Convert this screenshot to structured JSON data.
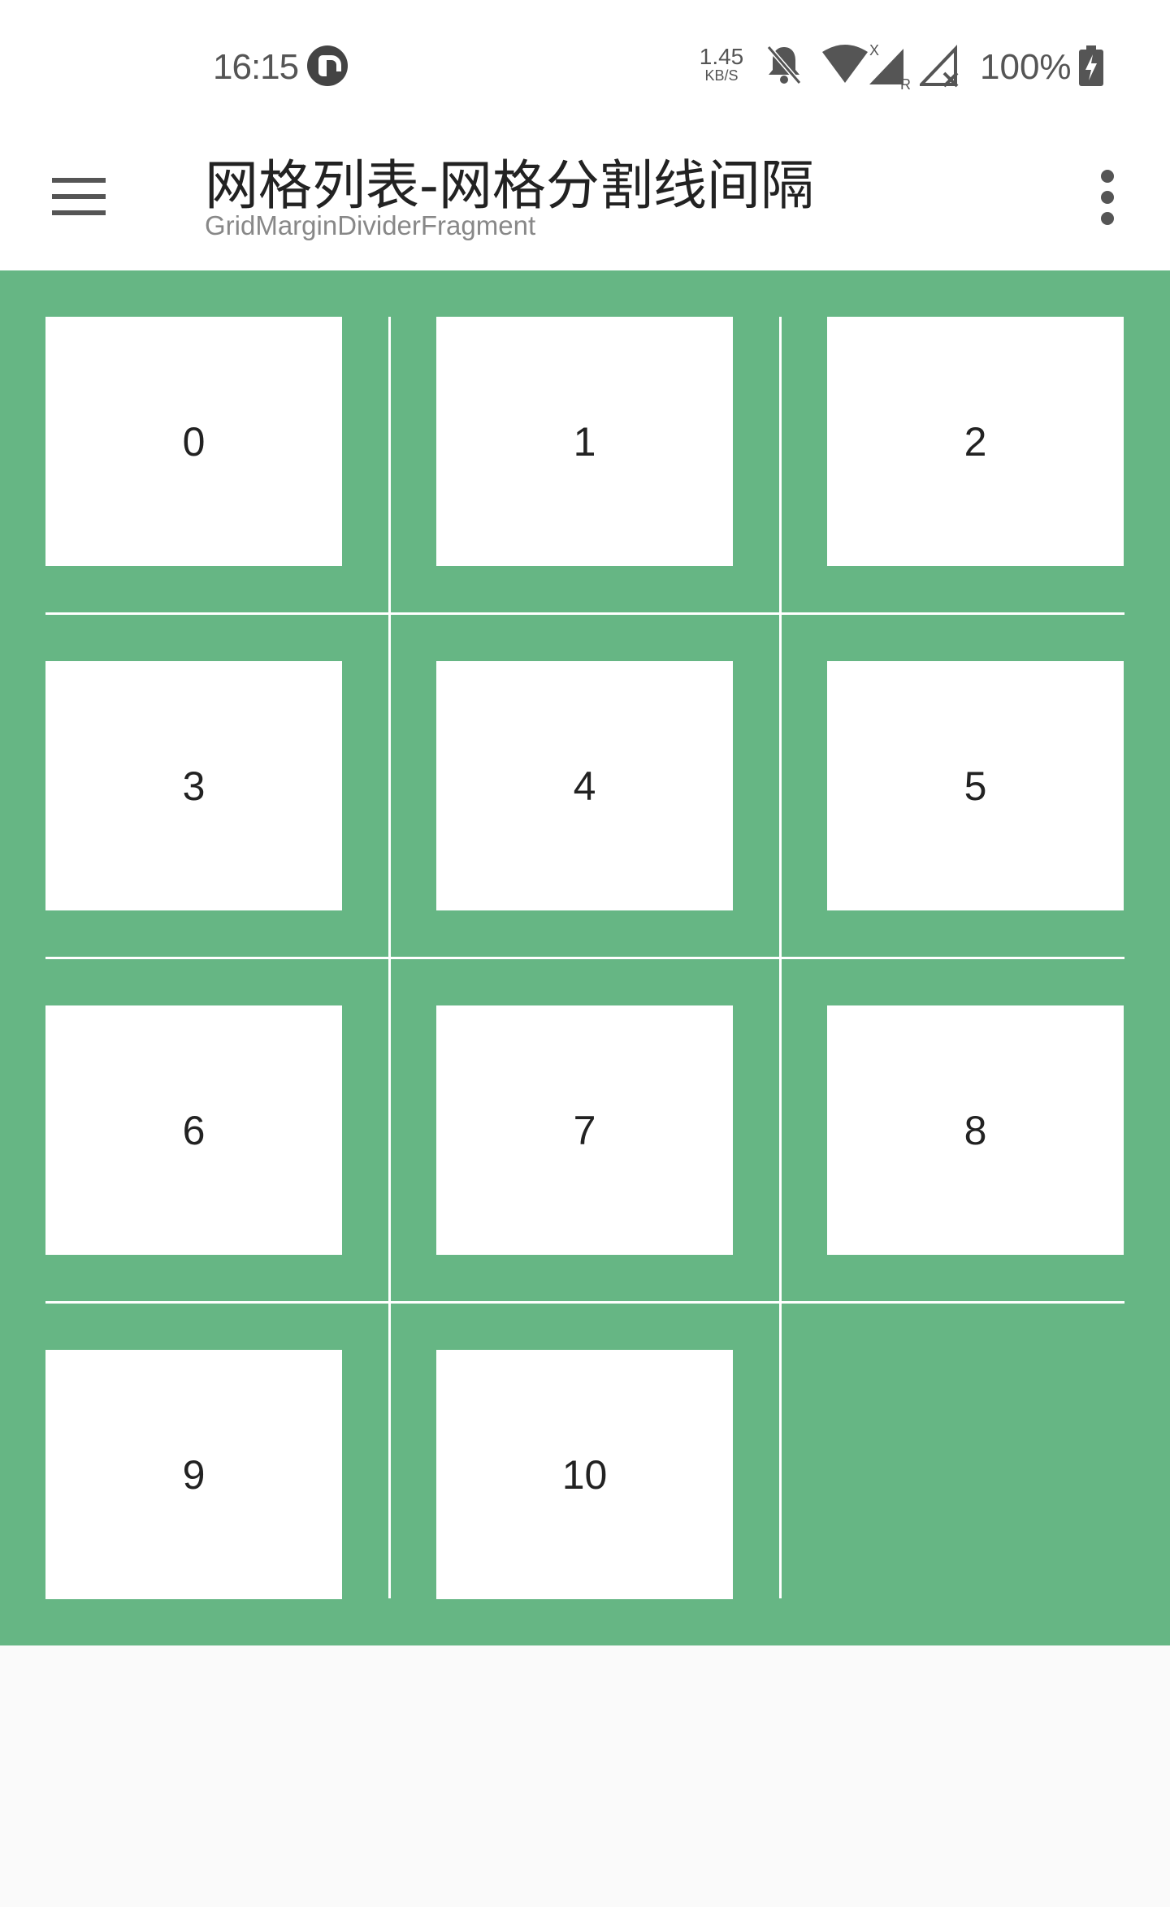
{
  "status_bar": {
    "time": "16:15",
    "net_speed_value": "1.45",
    "net_speed_unit": "KB/S",
    "battery": "100%",
    "icons": [
      "app-icon",
      "bell-off-icon",
      "wifi-icon",
      "signal-r-icon",
      "signal-x-icon",
      "battery-charging-icon"
    ]
  },
  "toolbar": {
    "title": "网格列表-网格分割线间隔",
    "subtitle": "GridMarginDividerFragment",
    "menu_icon": "hamburger-menu-icon",
    "overflow_icon": "more-vertical-icon"
  },
  "grid": {
    "items": [
      "0",
      "1",
      "2",
      "3",
      "4",
      "5",
      "6",
      "7",
      "8",
      "9",
      "10"
    ],
    "colors": {
      "background": "#66b684",
      "cell": "#ffffff",
      "divider": "#ffffff"
    }
  }
}
